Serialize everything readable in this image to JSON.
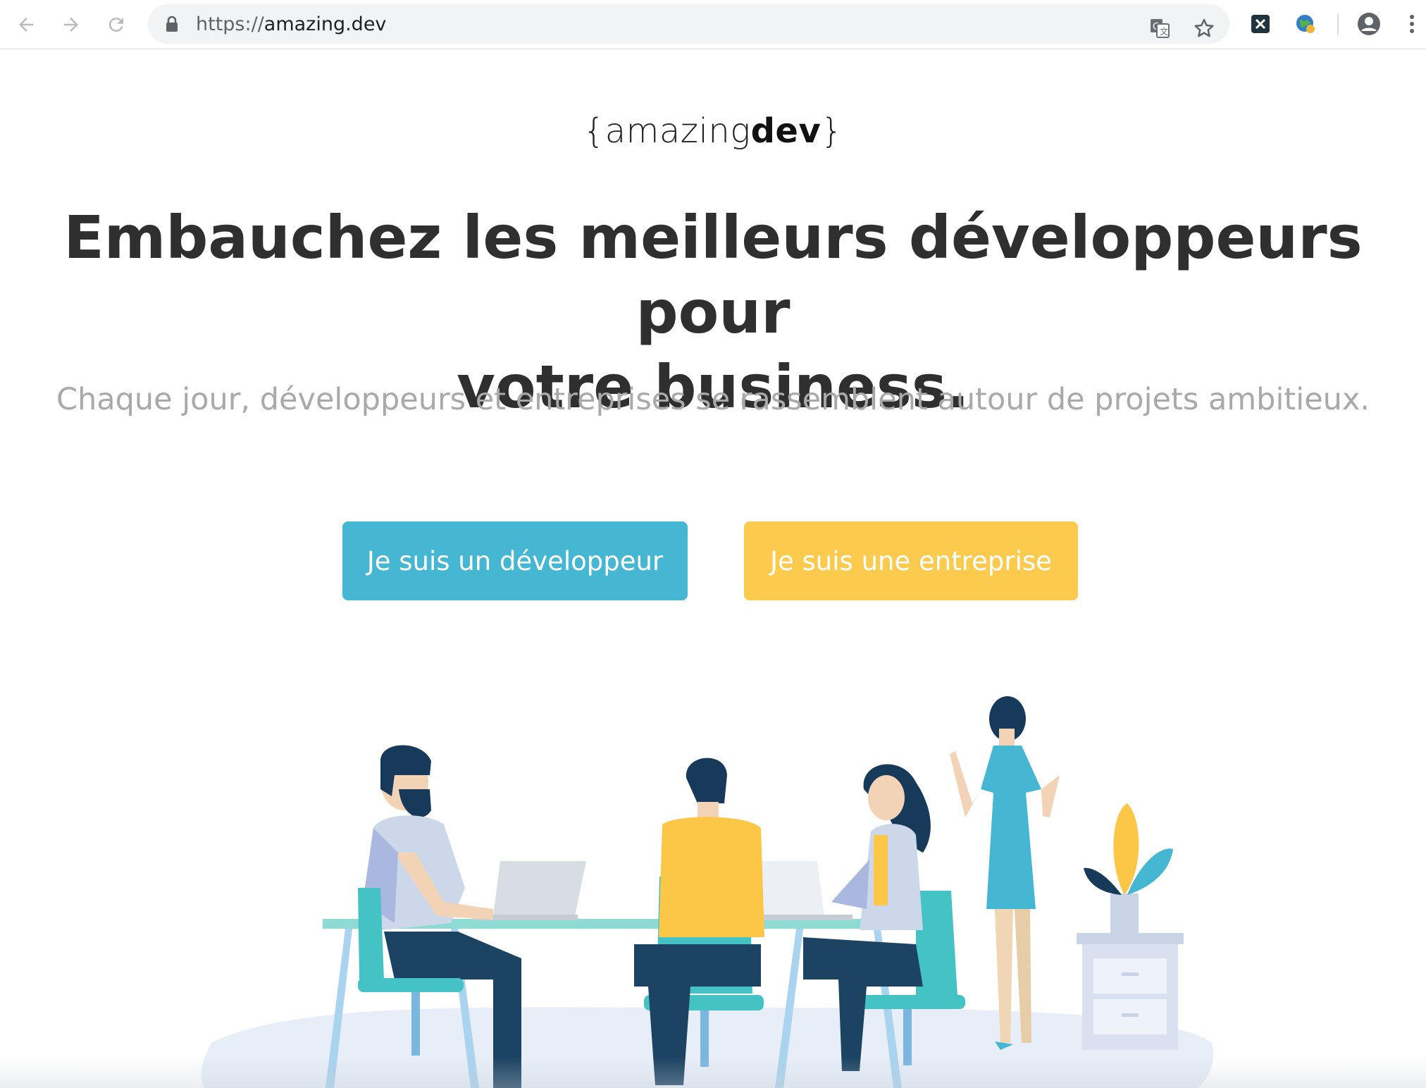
{
  "browser": {
    "url_scheme": "https://",
    "url_host": "amazing.dev",
    "icons": [
      "back-icon",
      "forward-icon",
      "reload-icon",
      "lock-icon",
      "translate-icon",
      "bookmark-star-icon",
      "extension-x-icon",
      "extension-globe-icon",
      "profile-icon",
      "menu-dots-icon"
    ]
  },
  "page": {
    "logo": {
      "open_brace": "{",
      "light": "amazing",
      "bold": "dev",
      "close_brace": "}"
    },
    "headline_line1": "Embauchez les meilleurs développeurs pour",
    "headline_line2": "votre business.",
    "subline": "Chaque jour, développeurs et entreprises se rassemblent autour de projets ambitieux.",
    "cta_developer": "Je suis un développeur",
    "cta_company": "Je suis une entreprise"
  },
  "colors": {
    "developer_button": "#45b7d3",
    "company_button": "#fccb4e",
    "headline": "#2f2f2f",
    "subline": "#a9a9a9"
  }
}
